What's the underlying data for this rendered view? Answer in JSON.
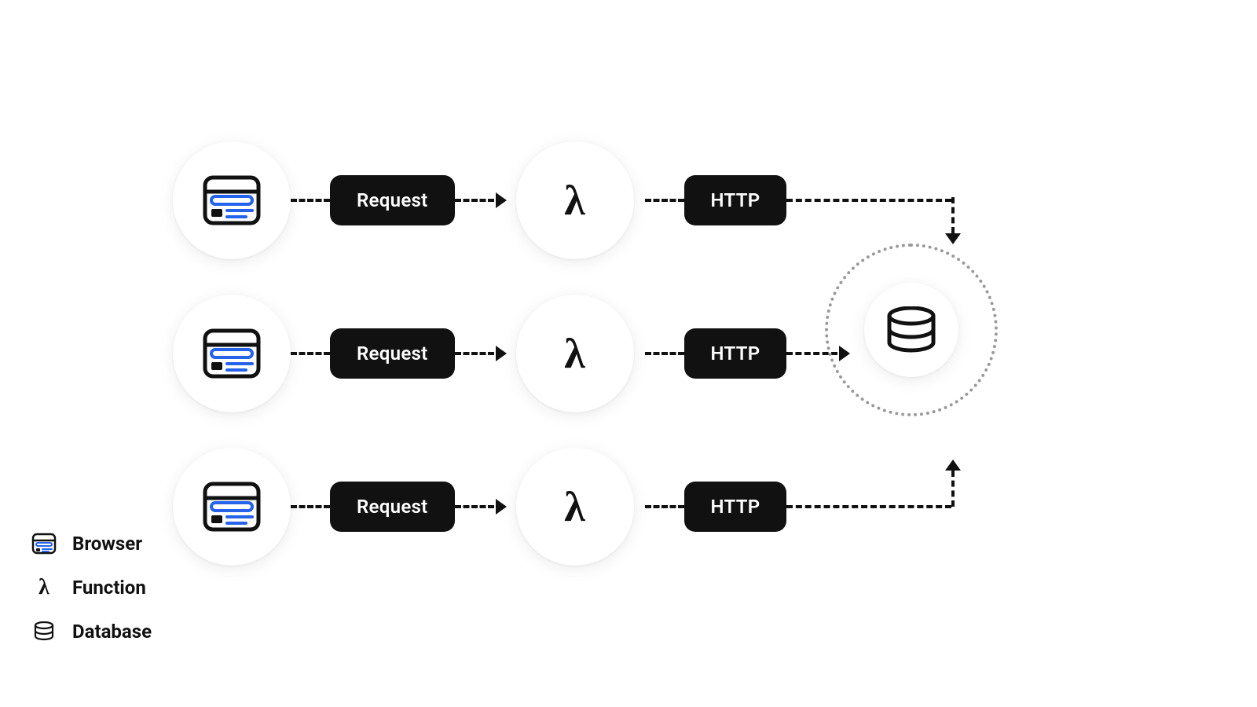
{
  "rows": [
    {
      "label1": "Request",
      "label2": "HTTP"
    },
    {
      "label1": "Request",
      "label2": "HTTP"
    },
    {
      "label1": "Request",
      "label2": "HTTP"
    }
  ],
  "legend": {
    "browser": "Browser",
    "function": "Function",
    "database": "Database"
  }
}
